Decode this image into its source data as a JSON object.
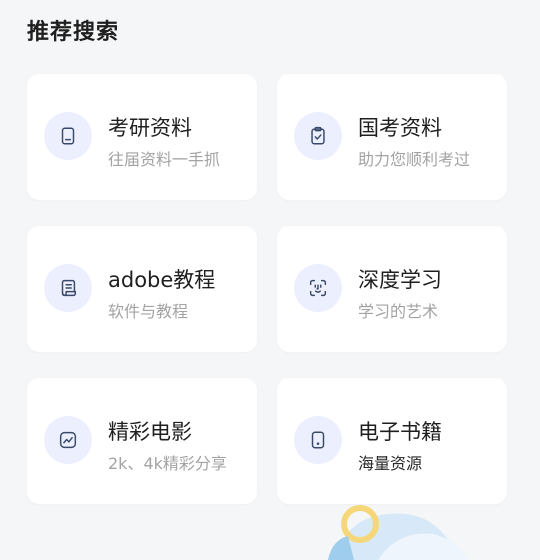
{
  "section": {
    "title": "推荐搜索"
  },
  "cards": [
    {
      "title": "考研资料",
      "subtitle": "往届资料一手抓",
      "icon": "document-icon"
    },
    {
      "title": "国考资料",
      "subtitle": "助力您顺利考过",
      "icon": "clipboard-check-icon"
    },
    {
      "title": "adobe教程",
      "subtitle": "软件与教程",
      "icon": "scroll-icon"
    },
    {
      "title": "深度学习",
      "subtitle": "学习的艺术",
      "icon": "face-scan-icon"
    },
    {
      "title": "精彩电影",
      "subtitle": "2k、4k精彩分享",
      "icon": "trend-chart-icon"
    },
    {
      "title": "电子书籍",
      "subtitle": "海量资源",
      "icon": "tablet-icon"
    }
  ],
  "colors": {
    "icon_stroke": "#3a4a6b",
    "icon_bg": "#eceffd",
    "card_bg": "#ffffff",
    "page_bg": "#f5f6f8"
  }
}
